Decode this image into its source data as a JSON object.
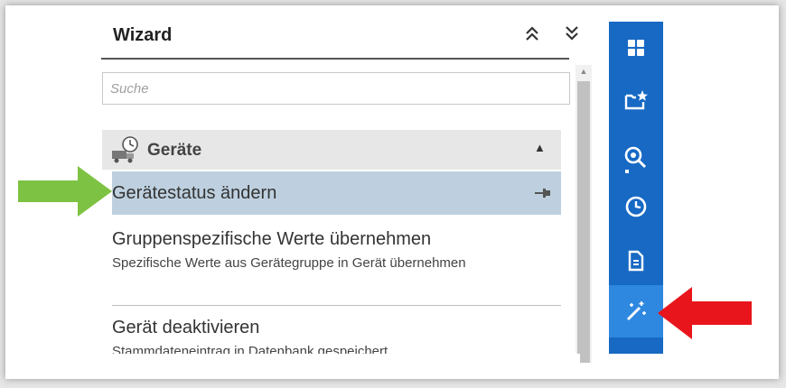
{
  "panel": {
    "title": "Wizard",
    "collapse_all_icon": "double-chevron-up-icon",
    "expand_all_icon": "double-chevron-down-icon"
  },
  "search": {
    "placeholder": "Suche",
    "value": ""
  },
  "group": {
    "label": "Geräte",
    "icon": "truck-clock-icon",
    "expanded": true
  },
  "items": [
    {
      "label": "Gerätestatus ändern",
      "description": "",
      "active": true,
      "pinned": true
    },
    {
      "label": "Gruppenspezifische Werte übernehmen",
      "description": "Spezifische Werte aus Gerätegruppe in Gerät übernehmen",
      "active": false
    },
    {
      "label": "Gerät deaktivieren",
      "description": "Stammdateneintrag in Datenbank gespeichert",
      "active": false
    }
  ],
  "sidebar": {
    "items": [
      {
        "icon": "dashboard-icon",
        "active": false
      },
      {
        "icon": "favorite-folder-icon",
        "active": false
      },
      {
        "icon": "search-zoom-icon",
        "active": false
      },
      {
        "icon": "clock-icon",
        "active": false
      },
      {
        "icon": "document-icon",
        "active": false
      },
      {
        "icon": "magic-wand-icon",
        "active": true
      }
    ]
  },
  "colors": {
    "sidebar_bg": "#1769c4",
    "sidebar_active": "#2f88e0",
    "active_item_bg": "#bed0df",
    "group_header_bg": "#e7e7e7",
    "green_arrow": "#7dc242",
    "red_arrow": "#e8161c"
  }
}
